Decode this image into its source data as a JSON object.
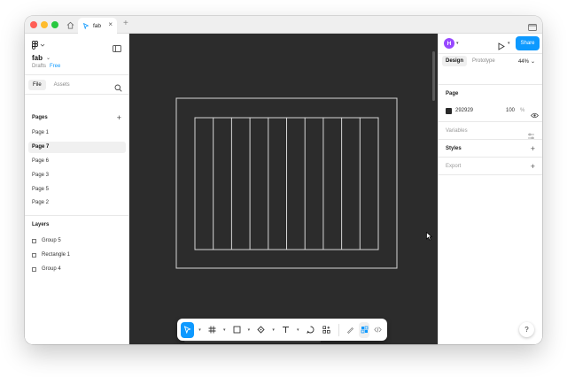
{
  "browser": {
    "tab_title": "fab",
    "new_tab": "+",
    "close": "×"
  },
  "left_panel": {
    "file_name": "fab",
    "file_caret": "⌄",
    "location": "Drafts",
    "plan_badge": "Free",
    "tabs": [
      "File",
      "Assets"
    ],
    "pages_title": "Pages",
    "pages_add": "+",
    "pages": [
      "Page 1",
      "Page 7",
      "Page 6",
      "Page 3",
      "Page 5",
      "Page 2"
    ],
    "active_page": "Page 7",
    "layers_title": "Layers",
    "layers": [
      "Group 5",
      "Rectangle 1",
      "Group 4"
    ]
  },
  "canvas": {
    "background": "#2c2c2c",
    "frame_columns": 10
  },
  "right_panel": {
    "avatar": "H",
    "share": "Share",
    "tabs": [
      "Design",
      "Prototype"
    ],
    "zoom": "44%",
    "zoom_caret": "⌄",
    "page_title": "Page",
    "page_color": "292929",
    "page_opacity": "100",
    "page_opacity_unit": "%",
    "variables": "Variables",
    "styles": "Styles",
    "export": "Export",
    "plus": "+",
    "help": "?"
  }
}
